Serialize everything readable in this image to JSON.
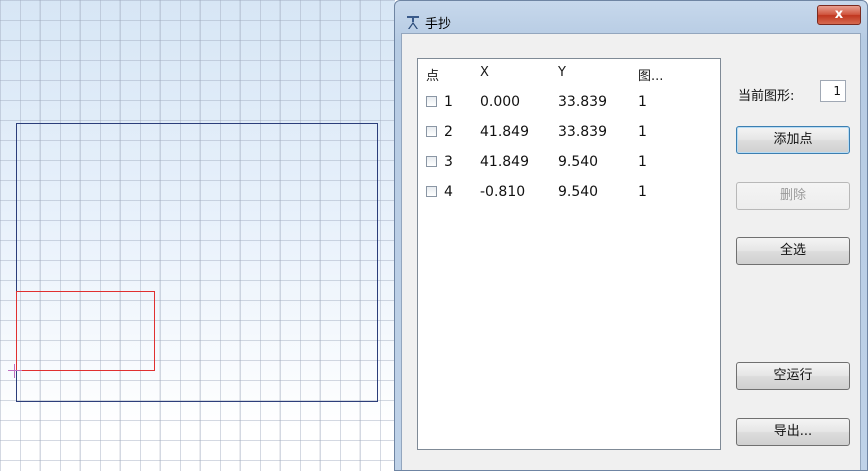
{
  "window": {
    "title": "手抄",
    "close_glyph": "x"
  },
  "points_list": {
    "columns": [
      "点",
      "X",
      "Y",
      "图..."
    ],
    "rows": [
      {
        "index": "1",
        "x": "0.000",
        "y": "33.839",
        "shape": "1"
      },
      {
        "index": "2",
        "x": "41.849",
        "y": "33.839",
        "shape": "1"
      },
      {
        "index": "3",
        "x": "41.849",
        "y": "9.540",
        "shape": "1"
      },
      {
        "index": "4",
        "x": "-0.810",
        "y": "9.540",
        "shape": "1"
      }
    ]
  },
  "current_shape": {
    "label": "当前图形:",
    "value": "1"
  },
  "buttons": {
    "add_point": "添加点",
    "delete": "删除",
    "select_all": "全选",
    "dry_run": "空运行",
    "export": "导出..."
  },
  "icons": {
    "title_icon": "compass-tool-icon",
    "close_icon": "close-icon"
  },
  "colors": {
    "outline_rect": "#2c3e7a",
    "selected_rect": "#e03030",
    "close_button": "#c0361f"
  }
}
